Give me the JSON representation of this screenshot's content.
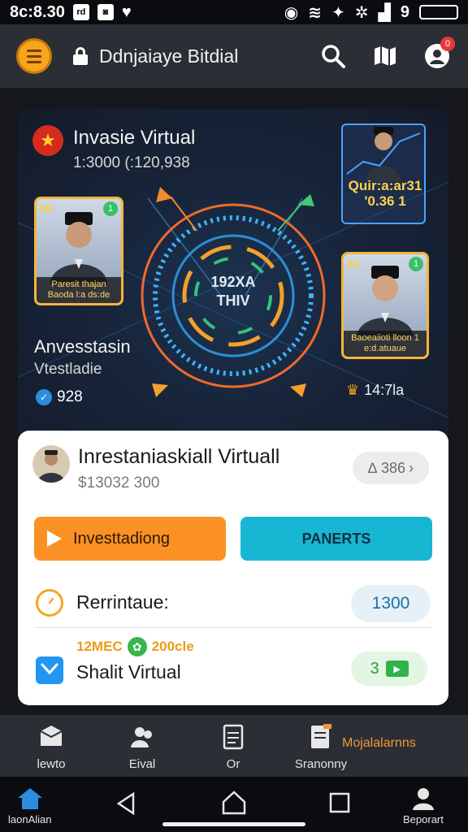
{
  "status_bar": {
    "time": "8c:8.30",
    "box1": "rd",
    "box2": "◙",
    "right_text": "9"
  },
  "header": {
    "title": "Ddnjaiaye Bitdial"
  },
  "notifications": {
    "count": "0"
  },
  "hero": {
    "title": "Invasie Virtual",
    "subtitle": "1:3000 (:120,938",
    "card_left": {
      "num": "00",
      "caption": "Paresit thajan Baoda l:a ds:de",
      "badge": "1"
    },
    "card_right": {
      "num": "10",
      "caption": "Baoeaiioti lloon 1 e:d.atuaue",
      "badge": "1"
    },
    "holo_text": "Quir:a:ar31 '0.36 1",
    "center_text": "192XA THIV",
    "left_title": "Anvesstasin",
    "left_sub": "Vtestladie",
    "check_value": "928",
    "right_stat": "14:7la"
  },
  "panel": {
    "title": "Inrestaniaskiall Virtuall",
    "amount": "$13032 300",
    "chip_value": "∆ 386",
    "invest_button": "Investtadiong",
    "panerts_button": "PANERTS",
    "row1_label": "Rerrintaue:",
    "row1_value": "1300",
    "row2_tag_left": "12MEC",
    "row2_tag_right": "200cle",
    "row2_label": "Shalit Virtual",
    "row2_value": "3"
  },
  "bottom_tabs": [
    {
      "label": "lewto"
    },
    {
      "label": "Eival"
    },
    {
      "label": "Or"
    },
    {
      "label": "Sranonny"
    },
    {
      "label": "Mojalalarnns"
    }
  ],
  "sys_nav": {
    "left_label": "laonAlian",
    "right_label": "Beporart"
  },
  "colors": {
    "accent_orange": "#fb9125",
    "accent_cyan": "#17b7d3",
    "header_bg": "#2b2e35"
  }
}
